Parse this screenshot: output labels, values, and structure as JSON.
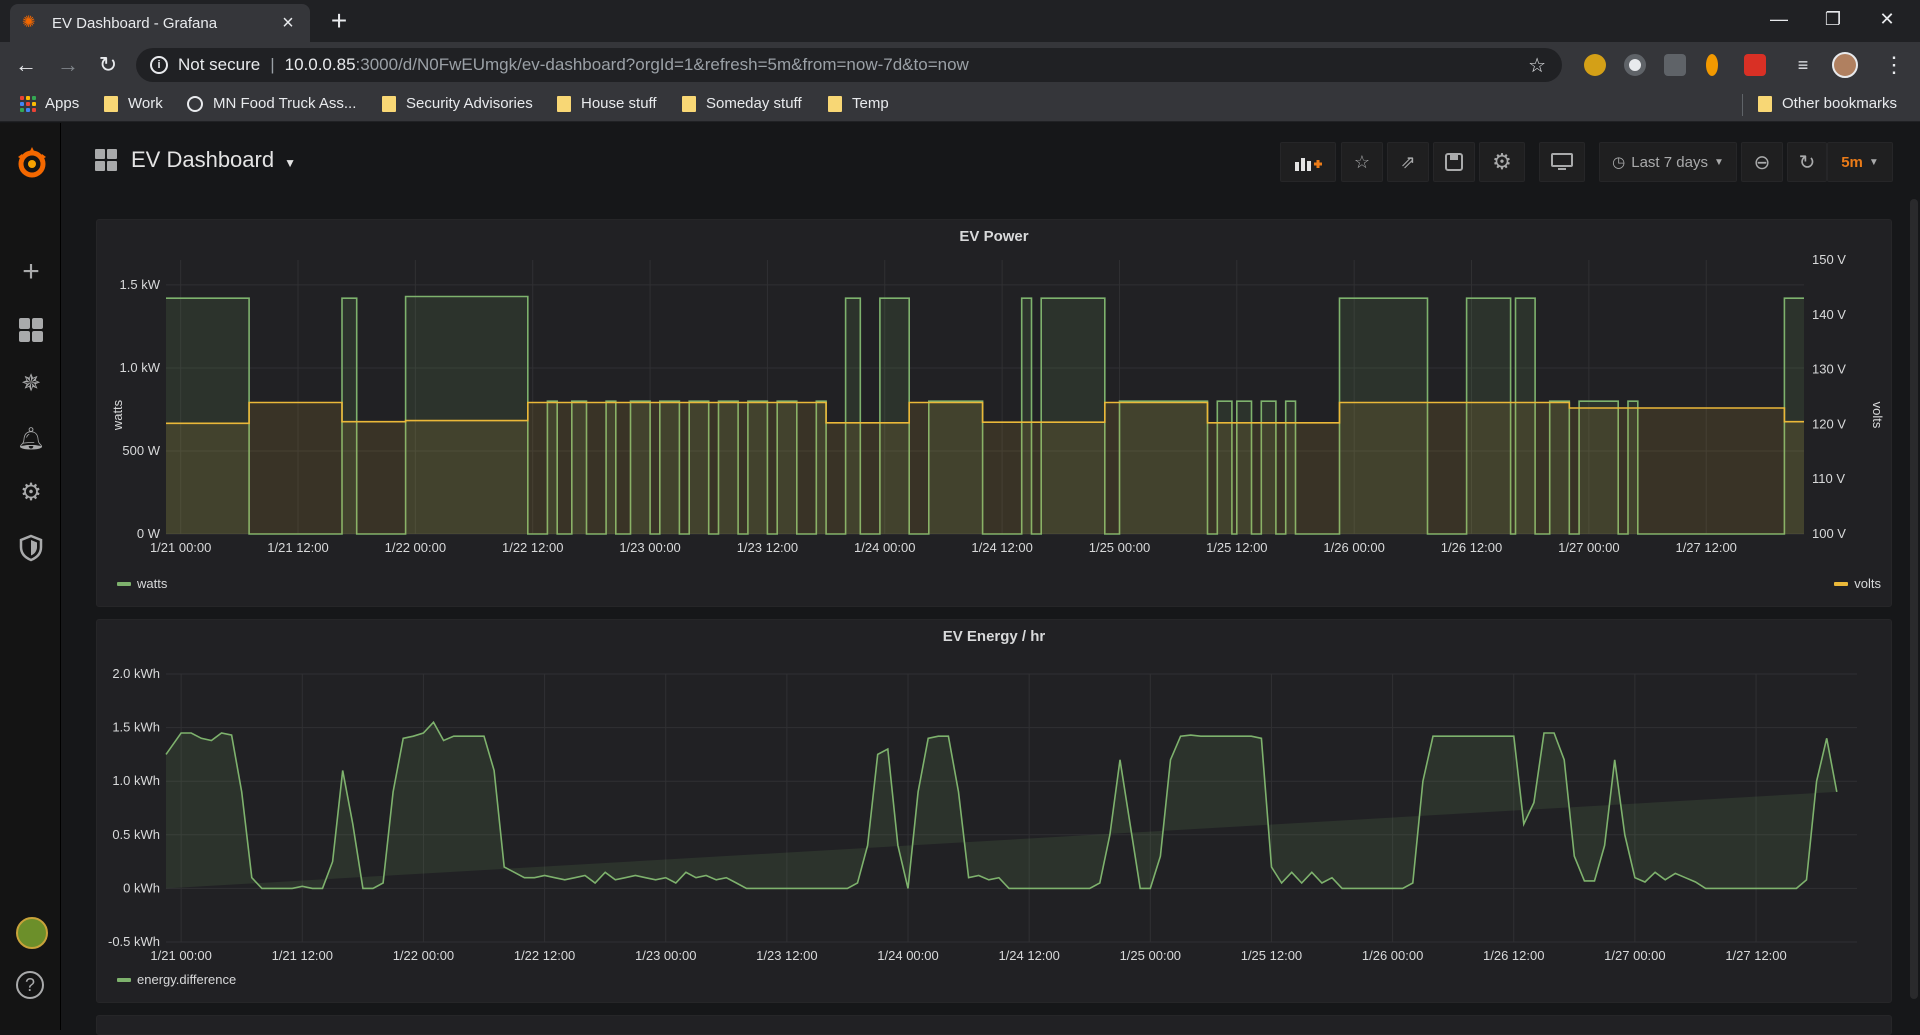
{
  "browser": {
    "tab_title": "EV Dashboard - Grafana",
    "new_tab": "+",
    "security_label": "Not secure",
    "url_host": "10.0.0.85",
    "url_path": ":3000/d/N0FwEUmgk/ev-dashboard?orgId=1&refresh=5m&from=now-7d&to=now",
    "window_controls": [
      "—",
      "❐",
      "✕"
    ]
  },
  "bookmarks": {
    "items": [
      "Apps",
      "Work",
      "MN Food Truck Ass...",
      "Security Advisories",
      "House stuff",
      "Someday stuff",
      "Temp"
    ],
    "other": "Other bookmarks"
  },
  "dashboard": {
    "title": "EV Dashboard",
    "time_range": "Last 7 days",
    "refresh_interval": "5m",
    "accent_color": "#eb7b18"
  },
  "panels": {
    "power": {
      "title": "EV Power",
      "left_unit_label": "watts",
      "right_unit_label": "volts",
      "legend_left": "watts",
      "legend_right": "volts"
    },
    "energy": {
      "title": "EV Energy / hr",
      "legend": "energy.difference"
    }
  },
  "chart_data": [
    {
      "type": "area",
      "title": "EV Power",
      "ylabel": "watts",
      "y2label": "volts",
      "x_ticks": [
        "1/21 00:00",
        "1/21 12:00",
        "1/22 00:00",
        "1/22 12:00",
        "1/23 00:00",
        "1/23 12:00",
        "1/24 00:00",
        "1/24 12:00",
        "1/25 00:00",
        "1/25 12:00",
        "1/26 00:00",
        "1/26 12:00",
        "1/27 00:00",
        "1/27 12:00"
      ],
      "y_ticks": [
        "0 W",
        "500 W",
        "1.0 kW",
        "1.5 kW"
      ],
      "y2_ticks": [
        "100 V",
        "110 V",
        "120 V",
        "130 V",
        "140 V",
        "150 V"
      ],
      "ylim": [
        0,
        1650
      ],
      "y2lim": [
        100,
        150
      ],
      "xlim_hours": [
        -1.5,
        166
      ],
      "series": [
        {
          "name": "watts",
          "color": "#7eb26d",
          "x_hours": [
            -1.5,
            -1.5,
            7,
            7,
            16.5,
            16.5,
            18,
            18,
            23,
            23,
            35.5,
            35.5,
            37.5,
            37.5,
            38.5,
            38.5,
            40,
            40,
            41.5,
            41.5,
            43.5,
            43.5,
            44.5,
            44.5,
            46,
            46,
            48,
            48,
            49,
            49,
            51,
            51,
            52,
            52,
            54,
            54,
            55,
            55,
            57,
            57,
            58,
            58,
            60,
            60,
            61,
            61,
            63,
            63,
            65,
            65,
            66,
            66,
            68,
            68,
            69.5,
            69.5,
            71.5,
            71.5,
            74.5,
            74.5,
            76.5,
            76.5,
            82,
            82,
            86,
            86,
            87,
            87,
            88,
            88,
            94.5,
            94.5,
            96,
            96,
            105,
            105,
            106,
            106,
            107.5,
            107.5,
            108,
            108,
            109.5,
            109.5,
            110.5,
            110.5,
            112,
            112,
            113,
            113,
            114,
            114,
            118.5,
            118.5,
            127.5,
            127.5,
            131.5,
            131.5,
            136,
            136,
            136.5,
            136.5,
            138.5,
            138.5,
            140,
            140,
            142,
            142,
            143,
            143,
            147,
            147,
            148,
            148,
            149,
            149,
            164,
            164,
            166
          ],
          "values": [
            1420,
            1420,
            1420,
            0,
            0,
            1420,
            1420,
            0,
            0,
            1430,
            1430,
            0,
            0,
            800,
            800,
            0,
            0,
            800,
            800,
            0,
            0,
            800,
            800,
            0,
            0,
            800,
            800,
            0,
            0,
            800,
            800,
            0,
            0,
            800,
            800,
            0,
            0,
            800,
            800,
            0,
            0,
            800,
            800,
            0,
            0,
            800,
            800,
            0,
            0,
            800,
            800,
            0,
            0,
            1420,
            1420,
            0,
            0,
            1420,
            1420,
            0,
            0,
            800,
            800,
            0,
            0,
            1420,
            1420,
            0,
            0,
            1420,
            1420,
            0,
            0,
            800,
            800,
            0,
            0,
            800,
            800,
            0,
            0,
            800,
            800,
            0,
            0,
            800,
            800,
            0,
            0,
            800,
            800,
            0,
            0,
            1420,
            1420,
            0,
            0,
            1420,
            1420,
            0,
            0,
            1420,
            1420,
            0,
            0,
            800,
            800,
            0,
            0,
            800,
            800,
            0,
            0,
            800,
            800,
            0,
            0,
            1420,
            1420
          ]
        },
        {
          "name": "volts",
          "color": "#eab839",
          "axis": "right",
          "x_hours": [
            -1.5,
            7,
            7,
            16.5,
            16.5,
            23,
            23,
            35.5,
            35.5,
            54,
            54,
            66,
            66,
            74.5,
            74.5,
            82,
            82,
            94.5,
            94.5,
            105,
            105,
            118.5,
            118.5,
            127.5,
            127.5,
            142,
            142,
            164,
            164,
            166
          ],
          "values": [
            120.2,
            120.2,
            124,
            124,
            120.5,
            120.5,
            120.7,
            120.7,
            124,
            124,
            124,
            124,
            120.3,
            120.3,
            124,
            124,
            120.4,
            120.4,
            124,
            124,
            120.3,
            120.3,
            124,
            124,
            124,
            124,
            123,
            123,
            120.5,
            120.5
          ]
        }
      ]
    },
    {
      "type": "area",
      "title": "EV Energy / hr",
      "x_ticks": [
        "1/21 00:00",
        "1/21 12:00",
        "1/22 00:00",
        "1/22 12:00",
        "1/23 00:00",
        "1/23 12:00",
        "1/24 00:00",
        "1/24 12:00",
        "1/25 00:00",
        "1/25 12:00",
        "1/26 00:00",
        "1/26 12:00",
        "1/27 00:00",
        "1/27 12:00"
      ],
      "y_ticks": [
        "-0.5 kWh",
        "0 kWh",
        "0.5 kWh",
        "1.0 kWh",
        "1.5 kWh",
        "2.0 kWh"
      ],
      "ylim": [
        -0.5,
        2.0
      ],
      "xlim_hours": [
        -1.5,
        166
      ],
      "series": [
        {
          "name": "energy.difference",
          "color": "#7eb26d",
          "x_hours": [
            -1.5,
            0,
            1,
            2,
            3,
            4,
            5,
            6,
            7,
            8,
            9,
            10,
            11,
            12,
            13,
            14,
            15,
            16,
            17,
            18,
            19,
            20,
            21,
            22,
            23,
            24,
            25,
            26,
            27,
            28,
            29,
            30,
            31,
            32,
            33,
            34,
            35,
            36,
            37,
            38,
            39,
            40,
            41,
            42,
            43,
            44,
            45,
            46,
            47,
            48,
            49,
            50,
            51,
            52,
            53,
            54,
            55,
            56,
            57,
            58,
            59,
            60,
            61,
            62,
            63,
            64,
            65,
            66,
            67,
            68,
            69,
            70,
            71,
            72,
            73,
            74,
            75,
            76,
            77,
            78,
            79,
            80,
            81,
            82,
            83,
            84,
            85,
            86,
            87,
            88,
            89,
            90,
            91,
            92,
            93,
            94,
            95,
            96,
            97,
            98,
            99,
            100,
            101,
            102,
            103,
            104,
            105,
            106,
            107,
            108,
            109,
            110,
            111,
            112,
            113,
            114,
            115,
            116,
            117,
            118,
            119,
            120,
            121,
            122,
            123,
            124,
            125,
            126,
            127,
            128,
            129,
            130,
            131,
            132,
            133,
            134,
            135,
            136,
            137,
            138,
            139,
            140,
            141,
            142,
            143,
            144,
            145,
            146,
            147,
            148,
            149,
            150,
            151,
            152,
            153,
            154,
            155,
            156,
            157,
            158,
            159,
            160,
            161,
            162,
            163,
            164,
            165,
            166
          ],
          "values": [
            1.25,
            1.45,
            1.45,
            1.4,
            1.38,
            1.45,
            1.43,
            0.9,
            0.1,
            0.0,
            0.0,
            0.0,
            0.0,
            0.02,
            0.0,
            0.0,
            0.25,
            1.1,
            0.6,
            0.0,
            0.0,
            0.05,
            0.9,
            1.4,
            1.42,
            1.45,
            1.55,
            1.38,
            1.42,
            1.42,
            1.42,
            1.42,
            1.1,
            0.2,
            0.15,
            0.1,
            0.1,
            0.12,
            0.1,
            0.08,
            0.1,
            0.12,
            0.05,
            0.15,
            0.08,
            0.1,
            0.12,
            0.1,
            0.08,
            0.1,
            0.05,
            0.15,
            0.1,
            0.12,
            0.08,
            0.1,
            0.05,
            0.0,
            0.0,
            0.0,
            0.0,
            0.0,
            0.0,
            0.0,
            0.0,
            0.0,
            0.0,
            0.0,
            0.05,
            0.4,
            1.25,
            1.3,
            0.4,
            0.0,
            0.9,
            1.4,
            1.42,
            1.42,
            0.9,
            0.1,
            0.12,
            0.08,
            0.1,
            0.0,
            0.0,
            0.0,
            0.0,
            0.0,
            0.0,
            0.0,
            0.0,
            0.0,
            0.05,
            0.5,
            1.2,
            0.6,
            0.0,
            0.0,
            0.3,
            1.2,
            1.42,
            1.43,
            1.42,
            1.42,
            1.42,
            1.42,
            1.42,
            1.42,
            1.4,
            0.2,
            0.05,
            0.15,
            0.05,
            0.15,
            0.05,
            0.1,
            0.0,
            0.0,
            0.0,
            0.0,
            0.0,
            0.0,
            0.0,
            0.05,
            1.0,
            1.42,
            1.42,
            1.42,
            1.42,
            1.42,
            1.42,
            1.42,
            1.42,
            1.42,
            0.6,
            0.8,
            1.45,
            1.45,
            1.2,
            0.3,
            0.07,
            0.07,
            0.4,
            1.2,
            0.5,
            0.1,
            0.06,
            0.15,
            0.08,
            0.14,
            0.1,
            0.06,
            0.0,
            0.0,
            0.0,
            0.0,
            0.0,
            0.0,
            0.0,
            0.0,
            0.0,
            0.0,
            0.08,
            1.0,
            1.4,
            0.9
          ]
        }
      ]
    }
  ]
}
